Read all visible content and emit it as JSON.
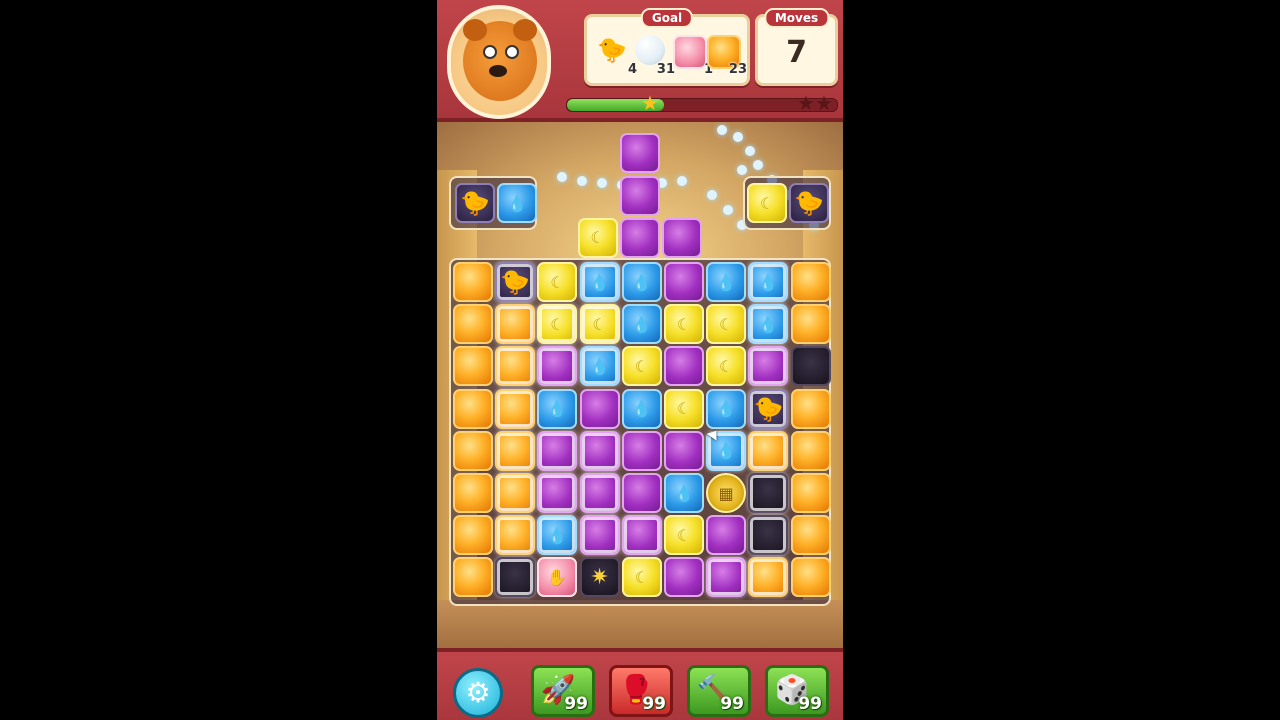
{
  "goal": {
    "label": "Goal",
    "items": [
      {
        "name": "duck",
        "icon": "duck-icon",
        "count": "4"
      },
      {
        "name": "bubble",
        "icon": "bubble-icon",
        "count": "31"
      },
      {
        "name": "pink-cube",
        "icon": "pink-cube-icon",
        "count": "1"
      },
      {
        "name": "orange-cube",
        "icon": "orange-cube-icon",
        "count": "23"
      }
    ]
  },
  "moves": {
    "label": "Moves",
    "value": "7"
  },
  "progress": {
    "fraction": 0.36,
    "stars_earned": 1,
    "stars_total": 3
  },
  "boosters": [
    {
      "name": "rocket",
      "icon": "rocket-icon",
      "count": "99"
    },
    {
      "name": "boxing-glove",
      "icon": "boxing-glove-icon",
      "count": "99"
    },
    {
      "name": "hammer",
      "icon": "hammer-icon",
      "count": "99"
    },
    {
      "name": "dice",
      "icon": "dice-icon",
      "count": "99"
    }
  ],
  "colors": {
    "orange": "#ff9f1a",
    "yellow": "#f6e02a",
    "blue": "#2c9ae8",
    "purple": "#a12fc0",
    "pink": "#f48aa6",
    "frame": "#b9353b"
  },
  "board": {
    "cols": 9,
    "rows": 8,
    "legend": "o=orange y=yellow b=blue p=purple k=pink d=duck x=dark z=disco-ball s=star-bomb ; suffix * = bubble",
    "grid": [
      [
        "o",
        "d*",
        "y",
        "b*",
        "b",
        "p",
        "b",
        "b*",
        "o"
      ],
      [
        "o",
        "o*",
        "y*",
        "y*",
        "b",
        "y",
        "y",
        "b*",
        "o"
      ],
      [
        "o",
        "o*",
        "p*",
        "b*",
        "y",
        "p",
        "y",
        "p*",
        "x"
      ],
      [
        "o",
        "o*",
        "b",
        "p",
        "b",
        "y",
        "b",
        "d*",
        "o"
      ],
      [
        "o",
        "o*",
        "p*",
        "p*",
        "p",
        "p",
        "b*",
        "o*",
        "o"
      ],
      [
        "o",
        "o*",
        "p*",
        "p*",
        "p",
        "b",
        "z",
        "x*",
        "o"
      ],
      [
        "o",
        "o*",
        "b*",
        "p*",
        "p*",
        "y",
        "p",
        "x*",
        "o"
      ],
      [
        "o",
        "x*",
        "k",
        "s",
        "y",
        "p",
        "p*",
        "o*",
        "o"
      ]
    ],
    "top_column": [
      {
        "col": 4,
        "row": -2,
        "type": "p"
      },
      {
        "col": 3,
        "row": -1,
        "type": "y"
      },
      {
        "col": 4,
        "row": -1,
        "type": "p"
      },
      {
        "col": 5,
        "row": -1,
        "type": "p"
      },
      {
        "col": 4,
        "row": -3,
        "type": "p"
      }
    ],
    "side_left": [
      "d",
      "b"
    ],
    "side_right": [
      "y",
      "d"
    ]
  }
}
